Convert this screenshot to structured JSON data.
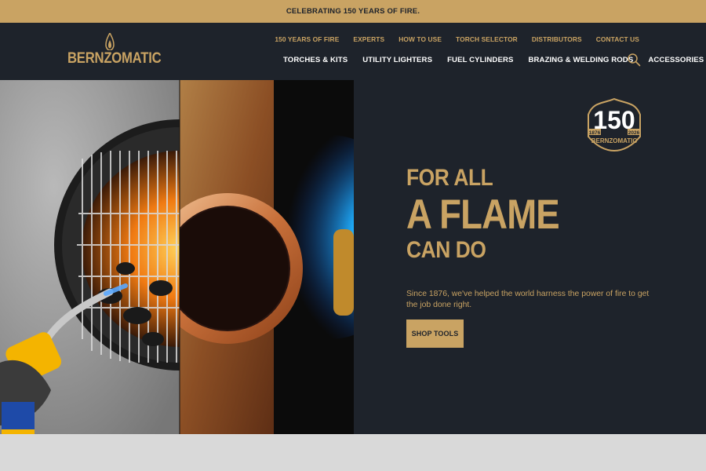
{
  "announcement": "CELEBRATING 150 YEARS OF FIRE.",
  "brand": {
    "name": "BERNZOMATIC"
  },
  "secondary_nav": [
    "150 YEARS OF FIRE",
    "EXPERTS",
    "HOW TO USE",
    "TORCH SELECTOR",
    "DISTRIBUTORS",
    "CONTACT US"
  ],
  "main_nav": [
    "TORCHES & KITS",
    "UTILITY LIGHTERS",
    "FUEL CYLINDERS",
    "BRAZING & WELDING RODS",
    "ACCESSORIES"
  ],
  "hero": {
    "line1": "FOR ALL",
    "line2": "A FLAME",
    "line3": "CAN DO",
    "description": "Since 1876, we've helped the world harness the power of fire to get the job done right.",
    "cta": "SHOP TOOLS"
  },
  "badge": {
    "number": "150",
    "year_start": "1876",
    "year_end": "2026",
    "brand": "BERNZOMATIC"
  },
  "colors": {
    "gold": "#c9a363",
    "navy": "#1e232b",
    "flame_blue": "#1fa3ff"
  },
  "icons": [
    "flame-logo-icon",
    "search-icon"
  ]
}
